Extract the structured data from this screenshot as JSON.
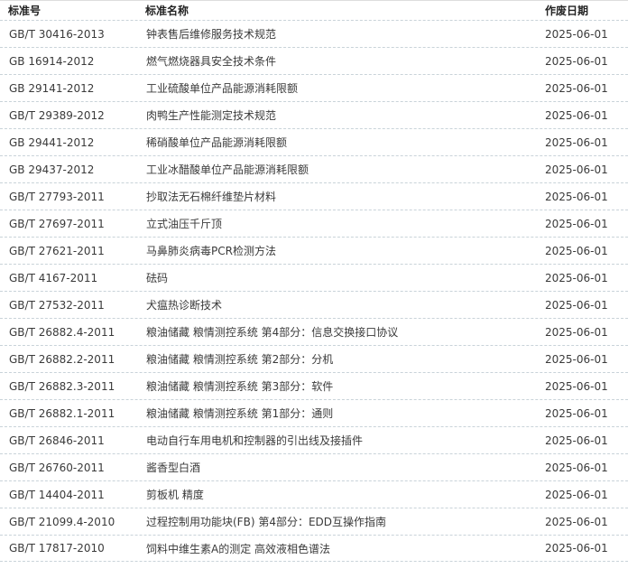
{
  "header": {
    "code": "标准号",
    "name": "标准名称",
    "date": "作废日期"
  },
  "rows": [
    {
      "code": "GB/T 30416-2013",
      "name": "钟表售后维修服务技术规范",
      "date": "2025-06-01"
    },
    {
      "code": "GB 16914-2012",
      "name": "燃气燃烧器具安全技术条件",
      "date": "2025-06-01"
    },
    {
      "code": "GB 29141-2012",
      "name": "工业硫酸单位产品能源消耗限额",
      "date": "2025-06-01"
    },
    {
      "code": "GB/T 29389-2012",
      "name": "肉鸭生产性能测定技术规范",
      "date": "2025-06-01"
    },
    {
      "code": "GB 29441-2012",
      "name": "稀硝酸单位产品能源消耗限额",
      "date": "2025-06-01"
    },
    {
      "code": "GB 29437-2012",
      "name": "工业冰醋酸单位产品能源消耗限额",
      "date": "2025-06-01"
    },
    {
      "code": "GB/T 27793-2011",
      "name": "抄取法无石棉纤维垫片材料",
      "date": "2025-06-01"
    },
    {
      "code": "GB/T 27697-2011",
      "name": "立式油压千斤顶",
      "date": "2025-06-01"
    },
    {
      "code": "GB/T 27621-2011",
      "name": "马鼻肺炎病毒PCR检测方法",
      "date": "2025-06-01"
    },
    {
      "code": "GB/T 4167-2011",
      "name": "砝码",
      "date": "2025-06-01"
    },
    {
      "code": "GB/T 27532-2011",
      "name": "犬瘟热诊断技术",
      "date": "2025-06-01"
    },
    {
      "code": "GB/T 26882.4-2011",
      "name": "粮油储藏 粮情测控系统 第4部分：信息交换接口协议",
      "date": "2025-06-01"
    },
    {
      "code": "GB/T 26882.2-2011",
      "name": "粮油储藏 粮情测控系统 第2部分：分机",
      "date": "2025-06-01"
    },
    {
      "code": "GB/T 26882.3-2011",
      "name": "粮油储藏 粮情测控系统 第3部分：软件",
      "date": "2025-06-01"
    },
    {
      "code": "GB/T 26882.1-2011",
      "name": "粮油储藏 粮情测控系统 第1部分：通则",
      "date": "2025-06-01"
    },
    {
      "code": "GB/T 26846-2011",
      "name": "电动自行车用电机和控制器的引出线及接插件",
      "date": "2025-06-01"
    },
    {
      "code": "GB/T 26760-2011",
      "name": "酱香型白酒",
      "date": "2025-06-01"
    },
    {
      "code": "GB/T 14404-2011",
      "name": "剪板机 精度",
      "date": "2025-06-01"
    },
    {
      "code": "GB/T 21099.4-2010",
      "name": "过程控制用功能块(FB) 第4部分：EDD互操作指南",
      "date": "2025-06-01"
    },
    {
      "code": "GB/T 17817-2010",
      "name": "饲料中维生素A的测定 高效液相色谱法",
      "date": "2025-06-01"
    }
  ]
}
